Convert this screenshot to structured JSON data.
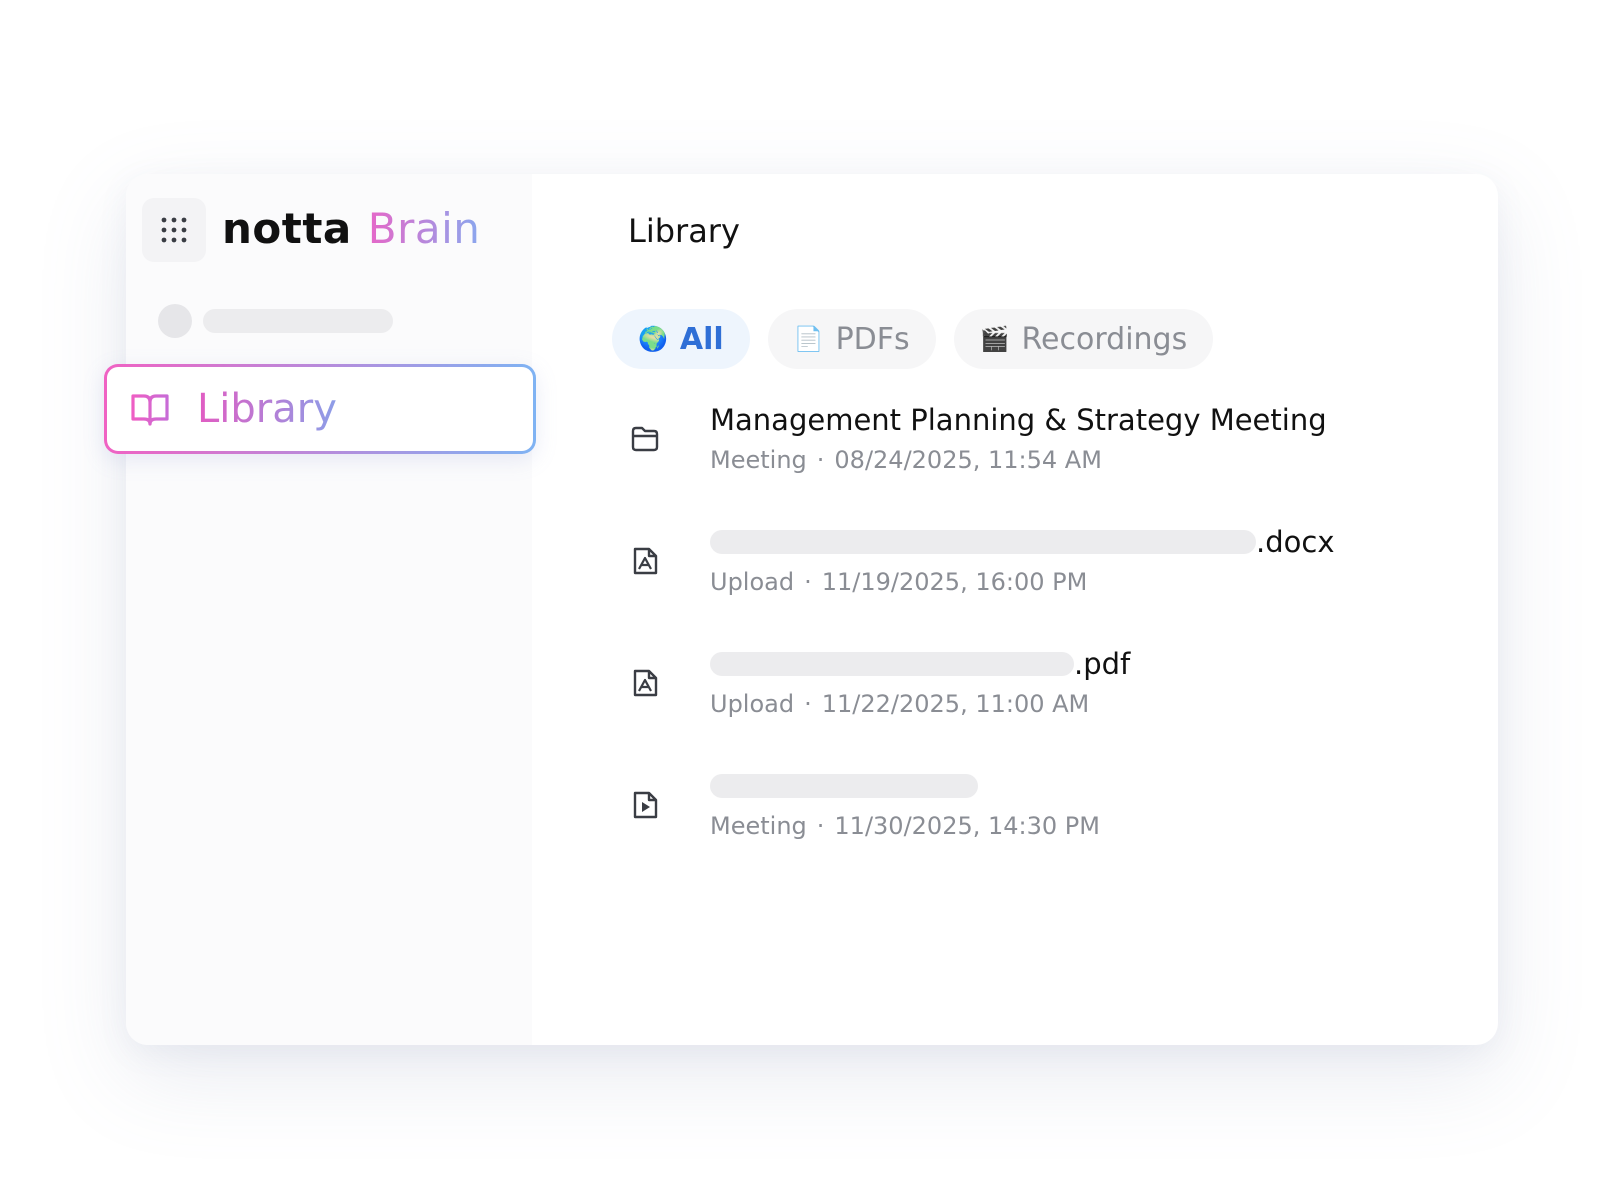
{
  "app": {
    "logo_primary": "notta",
    "logo_secondary": "Brain"
  },
  "sidebar": {
    "nav_item_label": "Library",
    "nav_item_icon": "book-icon"
  },
  "main": {
    "title": "Library",
    "tabs": [
      {
        "label": "All",
        "icon": "🌍",
        "active": true
      },
      {
        "label": "PDFs",
        "icon": "📄",
        "active": false
      },
      {
        "label": "Recordings",
        "icon": "🎬",
        "active": false
      }
    ],
    "items": [
      {
        "icon": "folder-icon",
        "title": "Management Planning & Strategy Meeting",
        "source": "Meeting",
        "datetime": "08/24/2025,  11:54 AM"
      },
      {
        "icon": "pdf-file-icon",
        "title_suffix": ".docx",
        "source": "Upload",
        "datetime": "11/19/2025, 16:00 PM"
      },
      {
        "icon": "pdf-file-icon",
        "title_suffix": ".pdf",
        "source": "Upload",
        "datetime": "11/22/2025, 11:00 AM"
      },
      {
        "icon": "video-file-icon",
        "title_suffix": "",
        "source": "Meeting",
        "datetime": "11/30/2025, 14:30 PM"
      }
    ],
    "meta_separator": "·"
  },
  "colors": {
    "accent_blue": "#2f6fd6",
    "gradient_pink": "#f062c3",
    "gradient_blue": "#7fb3f3"
  }
}
